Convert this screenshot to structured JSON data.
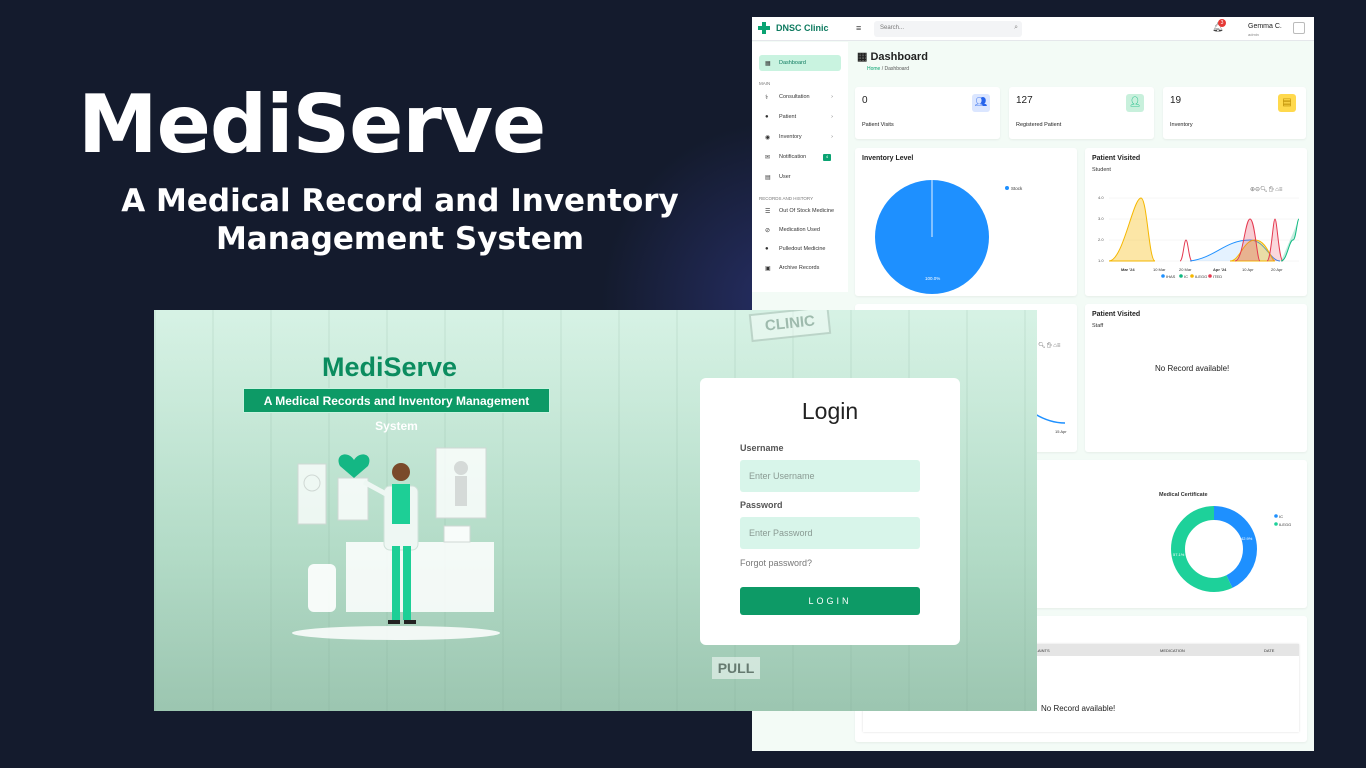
{
  "hero": {
    "title": "MediServe",
    "subtitle": "A Medical Record and Inventory Management System"
  },
  "dashboard": {
    "brand": "DNSC Clinic",
    "search_placeholder": "Search...",
    "notification_count": "3",
    "user_name": "Gemma C.",
    "user_role": "admin",
    "sidebar": {
      "dashboard": "Dashboard",
      "section_main": "MAIN",
      "items": [
        "Consultation",
        "Patient",
        "Inventory",
        "Notification",
        "User"
      ],
      "notification_badge": "4",
      "section_records": "RECORDS AND HISTORY",
      "records": [
        "Out Of Stock Medicine",
        "Medication Used",
        "Pulledout Medicine",
        "Archive Records"
      ]
    },
    "page_title": "Dashboard",
    "breadcrumb": {
      "home": "Home",
      "current": "Dashboard"
    },
    "stats": [
      {
        "value": "0",
        "label": "Patient Visits",
        "color": "#2563eb"
      },
      {
        "value": "127",
        "label": "Registered Patient",
        "color": "#10b981"
      },
      {
        "value": "19",
        "label": "Inventory",
        "color": "#f5b700"
      }
    ],
    "inventory_level": {
      "title": "Inventory Level",
      "legend": "Stock",
      "percent_label": "100.0%"
    },
    "patient_visited_student": {
      "title": "Patient Visited",
      "subtitle": "Student",
      "y_ticks": [
        "4.0",
        "3.0",
        "2.0",
        "1.0"
      ],
      "x_ticks": [
        "Mar '24",
        "10 Mar",
        "20 Mar",
        "Apr '24",
        "10 Apr",
        "20 Apr"
      ],
      "legend": [
        "IHAS",
        "IC",
        "ILEGG",
        "ITED"
      ]
    },
    "partial_chart_x_tick": "15 Apr",
    "patient_visited_staff": {
      "title": "Patient Visited",
      "subtitle": "Staff",
      "empty": "No Record available!"
    },
    "medical_certificate": {
      "title": "Medical Certificate",
      "legend": [
        "IC",
        "ILEGG"
      ],
      "label_a": "42.9%",
      "label_b": "57.1%"
    },
    "table": {
      "headers": [
        "PLAINTS",
        "MEDICATION",
        "DATE"
      ],
      "empty": "No Record available!"
    }
  },
  "login": {
    "app_title": "MediServe",
    "banner": "A Medical Records and Inventory Management System",
    "card_title": "Login",
    "username_label": "Username",
    "username_placeholder": "Enter Username",
    "password_label": "Password",
    "password_placeholder": "Enter Password",
    "forgot": "Forgot password?",
    "button": "LOGIN",
    "sign_clinic": "CLINIC",
    "sign_pull": "PULL"
  },
  "colors": {
    "background": "#141b2d",
    "primary": "#0d9a66",
    "input_bg": "#d8f5ea"
  }
}
